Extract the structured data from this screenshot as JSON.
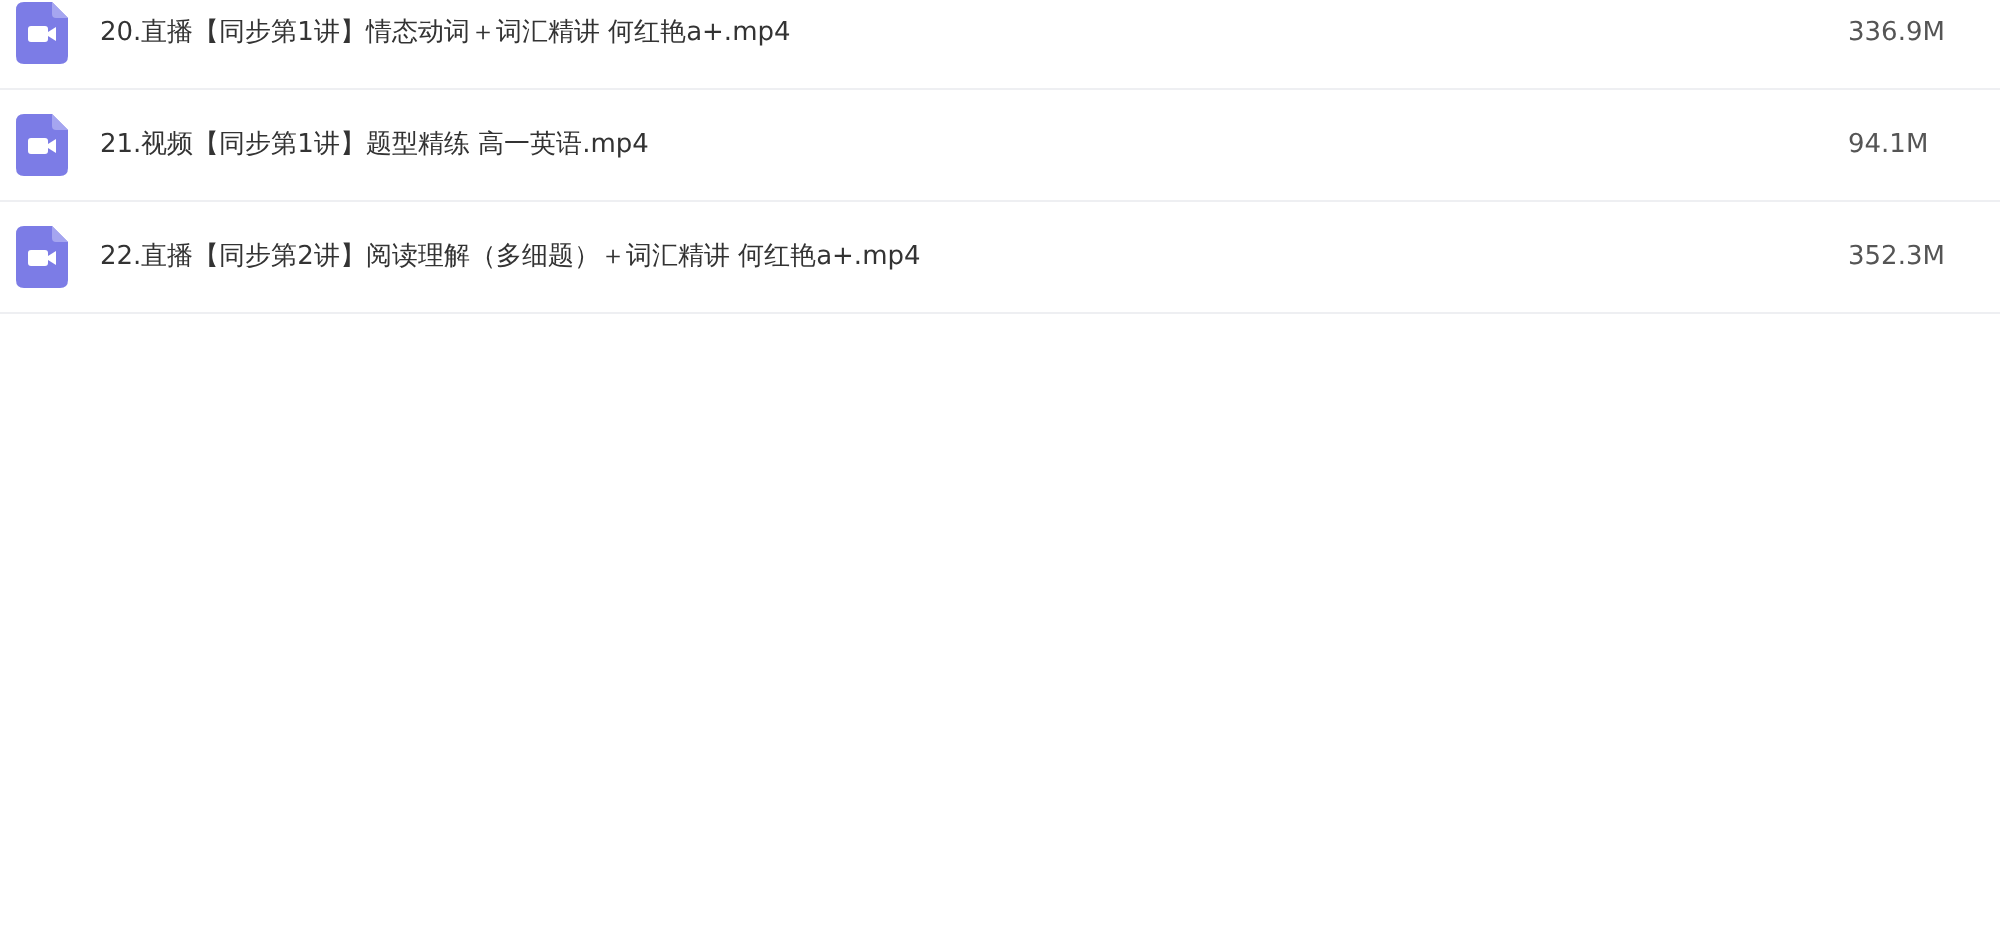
{
  "files": [
    {
      "name": "20.直播【同步第1讲】情态动词＋词汇精讲 何红艳a+.mp4",
      "size": "336.9M"
    },
    {
      "name": "21.视频【同步第1讲】题型精练 高一英语.mp4",
      "size": "94.1M"
    },
    {
      "name": "22.直播【同步第2讲】阅读理解（多细题）＋词汇精讲 何红艳a+.mp4",
      "size": "352.3M"
    }
  ]
}
